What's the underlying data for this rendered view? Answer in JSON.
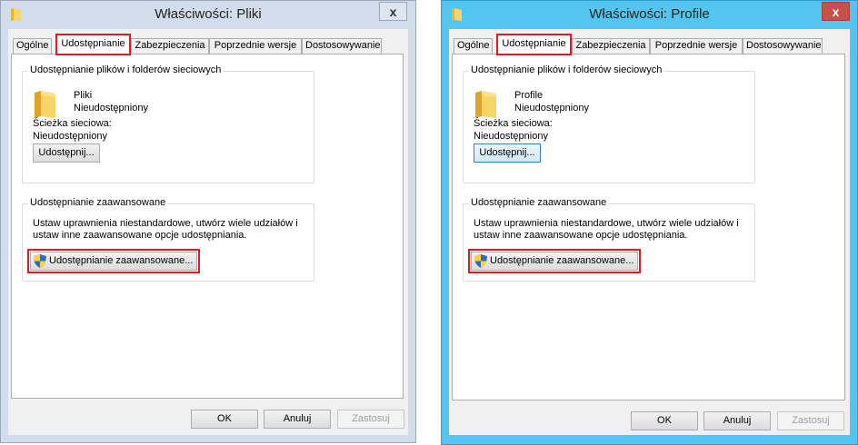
{
  "windows": [
    {
      "title": "Właściwości: Pliki",
      "close_label": "x",
      "tabs": [
        {
          "label": "Ogólne"
        },
        {
          "label": "Udostępnianie"
        },
        {
          "label": "Zabezpieczenia"
        },
        {
          "label": "Poprzednie wersje"
        },
        {
          "label": "Dostosowywanie"
        }
      ],
      "network_group": {
        "title": "Udostępnianie plików i folderów sieciowych",
        "folder_name": "Pliki",
        "folder_status": "Nieudostępniony",
        "path_label": "Ścieżka sieciowa:",
        "path_value": "Nieudostępniony",
        "share_button": "Udostępnij..."
      },
      "advanced_group": {
        "title": "Udostępnianie zaawansowane",
        "description_line1": "Ustaw uprawnienia niestandardowe, utwórz wiele udziałów i",
        "description_line2": "ustaw inne zaawansowane opcje udostępniania.",
        "button": "Udostępnianie zaawansowane..."
      },
      "buttons": {
        "ok": "OK",
        "cancel": "Anuluj",
        "apply": "Zastosuj"
      }
    },
    {
      "title": "Właściwości: Profile",
      "close_label": "x",
      "tabs": [
        {
          "label": "Ogólne"
        },
        {
          "label": "Udostępnianie"
        },
        {
          "label": "Zabezpieczenia"
        },
        {
          "label": "Poprzednie wersje"
        },
        {
          "label": "Dostosowywanie"
        }
      ],
      "network_group": {
        "title": "Udostępnianie plików i folderów sieciowych",
        "folder_name": "Profile",
        "folder_status": "Nieudostępniony",
        "path_label": "Ścieżka sieciowa:",
        "path_value": "Nieudostępniony",
        "share_button": "Udostępnij..."
      },
      "advanced_group": {
        "title": "Udostępnianie zaawansowane",
        "description_line1": "Ustaw uprawnienia niestandardowe, utwórz wiele udziałów i",
        "description_line2": "ustaw inne zaawansowane opcje udostępniania.",
        "button": "Udostępnianie zaawansowane..."
      },
      "buttons": {
        "ok": "OK",
        "cancel": "Anuluj",
        "apply": "Zastosuj"
      }
    }
  ],
  "colors": {
    "window1_frame": "#d1ddeb",
    "window2_frame": "#54c5ee",
    "highlight": "#e01a22",
    "close_active": "#c7504b"
  },
  "icons": [
    "folder-icon",
    "close-icon",
    "uac-shield-icon"
  ]
}
